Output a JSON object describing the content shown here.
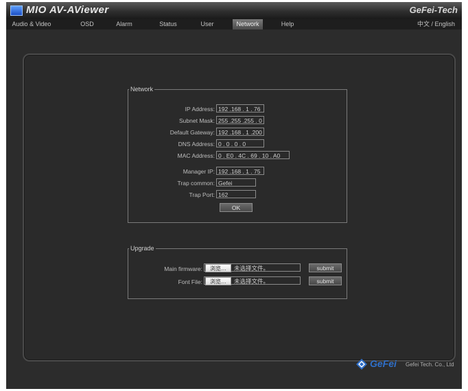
{
  "window": {
    "title": "MIO AV-AViewer",
    "brand": "GeFei-Tech"
  },
  "menu": {
    "items": [
      "Audio & Video",
      "OSD",
      "Alarm",
      "Status",
      "User",
      "Network",
      "Help"
    ],
    "active": "Network",
    "language": "中文 / English"
  },
  "network": {
    "title": "Network",
    "ip_address_label": "IP Address:",
    "ip_address": "192 .168 . 1 . 76",
    "subnet_mask_label": "Subnet Mask:",
    "subnet_mask": "255 .255 .255 . 0",
    "gateway_label": "Default Gateway:",
    "gateway": "192 .168 . 1 .200",
    "dns_label": "DNS Address:",
    "dns": "0 . 0 . 0 . 0",
    "mac_label": "MAC Address:",
    "mac": "0 . E0 . 4C . 69 . 10 . A0",
    "manager_ip_label": "Manager IP:",
    "manager_ip": "192 .168 . 1 . 75",
    "trap_common_label": "Trap common:",
    "trap_common": "Gefei",
    "trap_port_label": "Trap Port:",
    "trap_port": "162",
    "ok_label": "OK"
  },
  "upgrade": {
    "title": "Upgrade",
    "main_firmware_label": "Main firmware:",
    "font_file_label": "Font File:",
    "browse_label": "浏览…",
    "no_file_text": "未选择文件。",
    "submit_label": "submit"
  },
  "footer": {
    "logo_text": "GeFei",
    "company": "Gefei Tech. Co., Ltd"
  }
}
